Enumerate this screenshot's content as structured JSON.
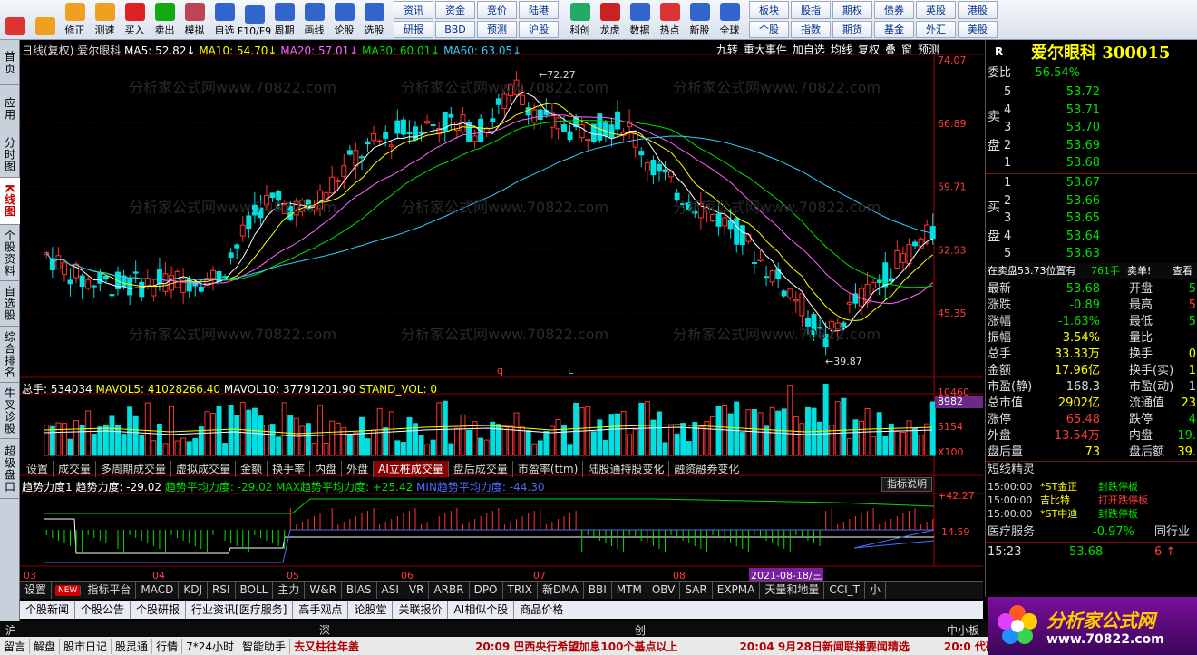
{
  "toolbar": {
    "buttons": [
      {
        "label": "",
        "icon": "grid-icon",
        "color": "#d33"
      },
      {
        "label": "",
        "icon": "back-arrow-icon",
        "color": "#f0a020"
      },
      {
        "label": "修正",
        "icon": "up-down-icon",
        "color": "#f0a020"
      },
      {
        "label": "测速",
        "icon": "stopwatch-icon",
        "color": "#f0a020"
      },
      {
        "label": "买入",
        "icon": "buy-icon",
        "color": "#d22"
      },
      {
        "label": "卖出",
        "icon": "sell-icon",
        "color": "#1a1"
      },
      {
        "label": "模拟",
        "icon": "hammer-icon",
        "color": "#b45"
      },
      {
        "label": "自选",
        "icon": "star-icon",
        "color": "#36c"
      },
      {
        "label": "F10/F9",
        "icon": "f10-icon",
        "color": "#36c"
      },
      {
        "label": "周期",
        "icon": "cycle-icon",
        "color": "#36c"
      },
      {
        "label": "画线",
        "icon": "pen-icon",
        "color": "#36c"
      },
      {
        "label": "论股",
        "icon": "discuss-icon",
        "color": "#36c"
      },
      {
        "label": "选股",
        "icon": "magnifier-icon",
        "color": "#36c"
      }
    ],
    "grid": [
      [
        "资讯",
        "研报"
      ],
      [
        "资金",
        "BBD"
      ],
      [
        "竞价",
        "预测"
      ],
      [
        "陆港",
        "沪股"
      ]
    ],
    "buttons2": [
      {
        "label": "科创",
        "icon": "tech-icon",
        "color": "#2a6"
      },
      {
        "label": "龙虎",
        "icon": "dragon-icon",
        "color": "#c22"
      },
      {
        "label": "数据",
        "icon": "pe-icon",
        "color": "#36c"
      },
      {
        "label": "热点",
        "icon": "hot-icon",
        "color": "#d33"
      },
      {
        "label": "新股",
        "icon": "ipo-icon",
        "color": "#36c"
      },
      {
        "label": "全球",
        "icon": "globe-icon",
        "color": "#36c"
      }
    ],
    "grid2": [
      [
        "板块",
        "个股"
      ],
      [
        "股指",
        "指数"
      ],
      [
        "期权",
        "期货"
      ],
      [
        "债券",
        "基金"
      ],
      [
        "英股",
        "外汇"
      ],
      [
        "港股",
        "美股"
      ]
    ]
  },
  "left_tabs": [
    {
      "label": "首页",
      "active": false
    },
    {
      "label": "应用",
      "active": false
    },
    {
      "label": "分时图",
      "active": false
    },
    {
      "label": "K线图",
      "active": true
    },
    {
      "label": "个股资料",
      "active": false
    },
    {
      "label": "自选股",
      "active": false
    },
    {
      "label": "综合排名",
      "active": false
    },
    {
      "label": "牛叉诊股",
      "active": false
    },
    {
      "label": "超级盘口",
      "active": false
    }
  ],
  "kline": {
    "period_label": "日线(复权)",
    "stock_name": "爱尔眼科",
    "ma": [
      {
        "label": "MA5: 52.82",
        "color": "#ffffff"
      },
      {
        "label": "MA10: 54.70",
        "color": "#ffff00"
      },
      {
        "label": "MA20: 57.01",
        "color": "#ff66ff"
      },
      {
        "label": "MA30: 60.01",
        "color": "#00e000"
      },
      {
        "label": "MA60: 63.05",
        "color": "#33ccff"
      }
    ],
    "top_buttons": [
      "九转",
      "重大事件",
      "加自选",
      "均线",
      "复权",
      "叠",
      "窗",
      "预测"
    ],
    "price_axis": [
      "74.07",
      "66.89",
      "59.71",
      "52.53",
      "45.35"
    ],
    "high_label": "72.27",
    "low_label": "39.87",
    "marker_q": "q",
    "marker_l": "L",
    "colors": {
      "up": "#ff3232",
      "down": "#00e0e0",
      "axis": "#b00000",
      "grid": "#8b0000"
    }
  },
  "volume": {
    "legend": [
      {
        "label": "总手: 534034",
        "color": "#ffffff"
      },
      {
        "label": "MAVOL5: 41028266.40",
        "color": "#ffff00"
      },
      {
        "label": "MAVOL10: 37791201.90",
        "color": "#ffffff"
      },
      {
        "label": "STAND_VOL: 0",
        "color": "#ffff00"
      }
    ],
    "axis": [
      "10460",
      "8982",
      "5154",
      "X100"
    ],
    "tabs": [
      {
        "label": "设置",
        "active": false
      },
      {
        "label": "成交量",
        "active": false
      },
      {
        "label": "多周期成交量",
        "active": false
      },
      {
        "label": "虚拟成交量",
        "active": false
      },
      {
        "label": "金额",
        "active": false
      },
      {
        "label": "换手率",
        "active": false
      },
      {
        "label": "内盘",
        "active": false
      },
      {
        "label": "外盘",
        "active": false
      },
      {
        "label": "AI立桩成交量",
        "active": true
      },
      {
        "label": "盘后成交量",
        "active": false
      },
      {
        "label": "市盈率(ttm)",
        "active": false
      },
      {
        "label": "陆股通持股变化",
        "active": false
      },
      {
        "label": "融资融券变化",
        "active": false
      }
    ]
  },
  "indicator": {
    "legend": [
      {
        "label": "趋势力度1 趋势力度: -29.02",
        "color": "#ffffff"
      },
      {
        "label": "趋势平均力度: -29.02",
        "color": "#00e000"
      },
      {
        "label": "MAX趋势平均力度: +25.42",
        "color": "#00e000"
      },
      {
        "label": "MIN趋势平均力度: -44.30",
        "color": "#4d6bff"
      }
    ],
    "help": "指标说明",
    "axis": [
      "+42.27",
      "-14.59"
    ]
  },
  "date_axis": [
    "03",
    "04",
    "05",
    "06",
    "07",
    "08"
  ],
  "date_highlight": "2021-08-18/三",
  "indicator_tabs": [
    "指标平台",
    "MACD",
    "KDJ",
    "RSI",
    "BOLL",
    "主力",
    "W&R",
    "BIAS",
    "ASI",
    "VR",
    "ARBR",
    "DPO",
    "TRIX",
    "新DMA",
    "BBI",
    "MTM",
    "OBV",
    "SAR",
    "EXPMA",
    "天量和地量",
    "CCI_T",
    "小"
  ],
  "new_badge": "NEW",
  "settings_label": "设置",
  "news_tabs": [
    "个股新闻",
    "个股公告",
    "个股研报",
    "行业资讯[医疗服务]",
    "高手观点",
    "论股堂",
    "关联报价",
    "AI相似个股",
    "商品价格"
  ],
  "index_bar": {
    "sh": "沪",
    "sz": "深",
    "cy": "创",
    "zx": "中小板指"
  },
  "status_bar": {
    "items": [
      "留言",
      "解盘",
      "股市日记",
      "股灵通",
      "行情",
      "7*24小时",
      "智能助手"
    ],
    "news1": "去又柱往年盖",
    "news2_time": "20:09",
    "news2": "巴西央行希望加息100个基点以上",
    "news3_time": "20:04",
    "news3": "9月28日新闻联播要闻精选",
    "news4_time": "20:0",
    "news4": "代码/名称"
  },
  "quote": {
    "r": "R",
    "name": "爱尔眼科",
    "code": "300015",
    "weibi_label": "委比",
    "weibi": "-56.54%",
    "sell_label": [
      "卖",
      "盘"
    ],
    "buy_label": [
      "买",
      "盘"
    ],
    "sell": [
      {
        "idx": "5",
        "price": "53.72"
      },
      {
        "idx": "4",
        "price": "53.71"
      },
      {
        "idx": "3",
        "price": "53.70"
      },
      {
        "idx": "2",
        "price": "53.69"
      },
      {
        "idx": "1",
        "price": "53.68"
      }
    ],
    "buy": [
      {
        "idx": "1",
        "price": "53.67"
      },
      {
        "idx": "2",
        "price": "53.66"
      },
      {
        "idx": "3",
        "price": "53.65"
      },
      {
        "idx": "4",
        "price": "53.64"
      },
      {
        "idx": "5",
        "price": "53.63"
      }
    ],
    "order_line": "在卖盘53.73位置有",
    "order_qty": "761手",
    "order_action": "卖单!",
    "order_link": "查看",
    "stats": [
      {
        "l1": "最新",
        "v1": "53.68",
        "c1": "g",
        "l2": "开盘",
        "v2": "5",
        "c2": "g"
      },
      {
        "l1": "涨跌",
        "v1": "-0.89",
        "c1": "g",
        "l2": "最高",
        "v2": "5",
        "c2": "r"
      },
      {
        "l1": "涨幅",
        "v1": "-1.63%",
        "c1": "g",
        "l2": "最低",
        "v2": "5",
        "c2": "g"
      },
      {
        "l1": "振幅",
        "v1": "3.54%",
        "c1": "y",
        "l2": "量比",
        "v2": "",
        "c2": "y"
      },
      {
        "l1": "总手",
        "v1": "33.33万",
        "c1": "y",
        "l2": "换手",
        "v2": "0",
        "c2": "y"
      },
      {
        "l1": "金额",
        "v1": "17.96亿",
        "c1": "y",
        "l2": "换手(实)",
        "v2": "1",
        "c2": "y"
      },
      {
        "l1": "市盈(静)",
        "v1": "168.3",
        "c1": "w",
        "l2": "市盈(动)",
        "v2": "1",
        "c2": "w"
      },
      {
        "l1": "总市值",
        "v1": "2902亿",
        "c1": "y",
        "l2": "流通值",
        "v2": "23",
        "c2": "y"
      },
      {
        "l1": "涨停",
        "v1": "65.48",
        "c1": "r",
        "l2": "跌停",
        "v2": "4",
        "c2": "g"
      },
      {
        "l1": "外盘",
        "v1": "13.54万",
        "c1": "r",
        "l2": "内盘",
        "v2": "19.",
        "c2": "g"
      },
      {
        "l1": "盘后量",
        "v1": "73",
        "c1": "y",
        "l2": "盘后额",
        "v2": "39.",
        "c2": "y"
      }
    ],
    "wizard_title": "短线精灵",
    "wizard": [
      {
        "time": "15:00:00",
        "name": "*ST金正",
        "event": "封跌停板"
      },
      {
        "time": "15:00:00",
        "name": "吉比特",
        "event": "打开跌停板"
      },
      {
        "time": "15:00:00",
        "name": "*ST中迪",
        "event": "封跌停板"
      }
    ],
    "sector_label": "医疗服务",
    "sector_pct": "-0.97%",
    "sector_link": "同行业",
    "tick_time": "15:23",
    "tick_price": "53.68",
    "tick_qty": "6"
  },
  "logo": {
    "title": "分析家公式网",
    "url": "www.70822.com"
  },
  "watermark": "分析家公式网www.70822.com"
}
